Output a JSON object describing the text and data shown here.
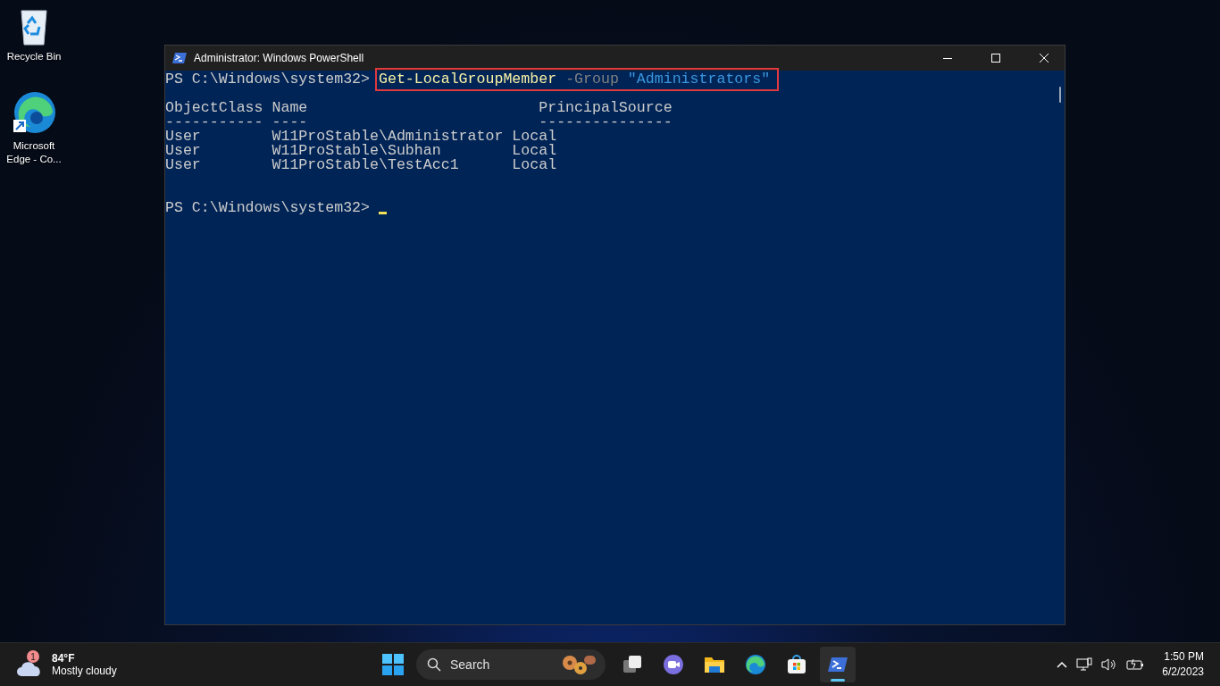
{
  "desktop_icons": [
    {
      "label": "Recycle Bin",
      "kind": "recycle"
    },
    {
      "label": "Microsoft\nEdge - Co...",
      "kind": "edge"
    }
  ],
  "window": {
    "title": "Administrator: Windows PowerShell",
    "console": [
      {
        "kind": "command",
        "prompt": "PS C:\\Windows\\system32> ",
        "command": "Get-LocalGroupMember",
        "parameter": "-Group",
        "argument": "\"Administrators\"",
        "highlighted": true
      },
      {
        "kind": "blank"
      },
      {
        "kind": "output",
        "text": "ObjectClass Name                          PrincipalSource"
      },
      {
        "kind": "output",
        "text": "----------- ----                          ---------------"
      },
      {
        "kind": "output",
        "text": "User        W11ProStable\\Administrator Local"
      },
      {
        "kind": "output",
        "text": "User        W11ProStable\\Subhan        Local"
      },
      {
        "kind": "output",
        "text": "User        W11ProStable\\TestAcc1      Local"
      },
      {
        "kind": "blank"
      },
      {
        "kind": "blank"
      },
      {
        "kind": "cursor",
        "prompt": "PS C:\\Windows\\system32> "
      }
    ]
  },
  "taskbar": {
    "weather": {
      "badge": "1",
      "temperature": "84°F",
      "condition": "Mostly cloudy"
    },
    "search": {
      "placeholder": "Search"
    },
    "apps": [
      {
        "kind": "taskview",
        "selected": false
      },
      {
        "kind": "chat",
        "selected": false
      },
      {
        "kind": "folder",
        "selected": false
      },
      {
        "kind": "edge",
        "selected": false
      },
      {
        "kind": "store",
        "selected": false
      },
      {
        "kind": "powershell",
        "selected": true
      }
    ],
    "clock": {
      "time": "1:50 PM",
      "date": "6/2/2023"
    }
  }
}
